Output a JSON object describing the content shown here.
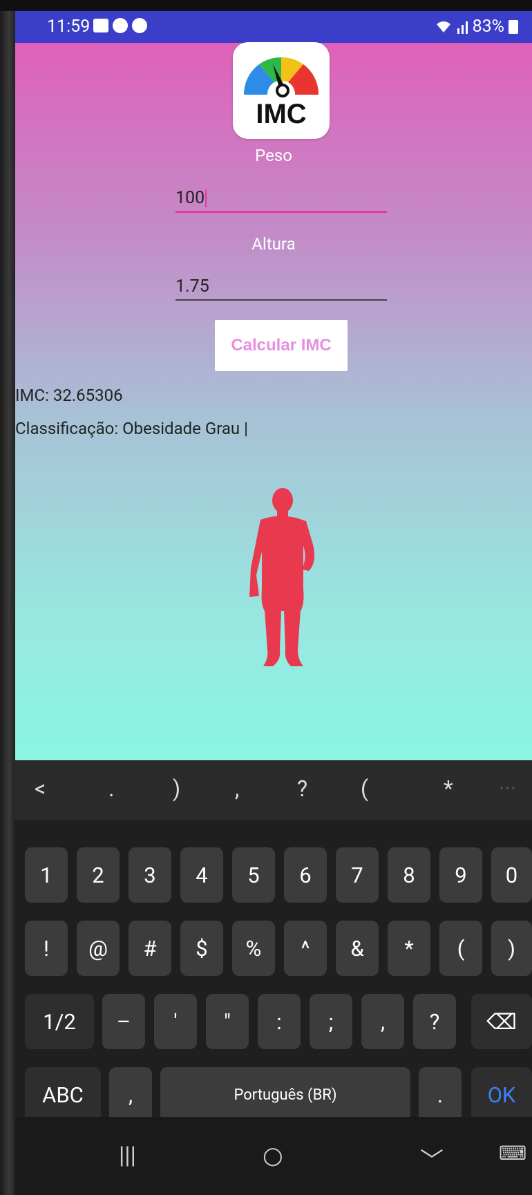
{
  "status": {
    "time": "11:59",
    "battery": "83%"
  },
  "app": {
    "logo_text": "IMC",
    "peso_label": "Peso",
    "peso_value": "100",
    "altura_label": "Altura",
    "altura_value": "1.75",
    "button_label": "Calcular IMC",
    "imc_result": "IMC: 32.65306",
    "classification": "Classificação: Obesidade Grau |"
  },
  "keyboard": {
    "suggestions": [
      "<",
      ".",
      ")",
      ",",
      "?",
      "(",
      "*",
      "···"
    ],
    "row1": [
      "1",
      "2",
      "3",
      "4",
      "5",
      "6",
      "7",
      "8",
      "9",
      "0"
    ],
    "row2": [
      "!",
      "@",
      "#",
      "$",
      "%",
      "^",
      "&",
      "*",
      "(",
      ")"
    ],
    "row3": [
      "1/2",
      "–",
      "'",
      "\"",
      ":",
      ";",
      ",",
      "?",
      "⌫"
    ],
    "abc": "ABC",
    "comma": ",",
    "space": "Português (BR)",
    "period": ".",
    "ok": "OK"
  },
  "navbar": {
    "recents": "|||",
    "home": "○",
    "back": "﹀",
    "keyboard": "⌨"
  },
  "colors": {
    "accent": "#e03f91",
    "statusbar": "#3b3ec9",
    "silhouette": "#e8394f",
    "button_text": "#e98ee0"
  }
}
